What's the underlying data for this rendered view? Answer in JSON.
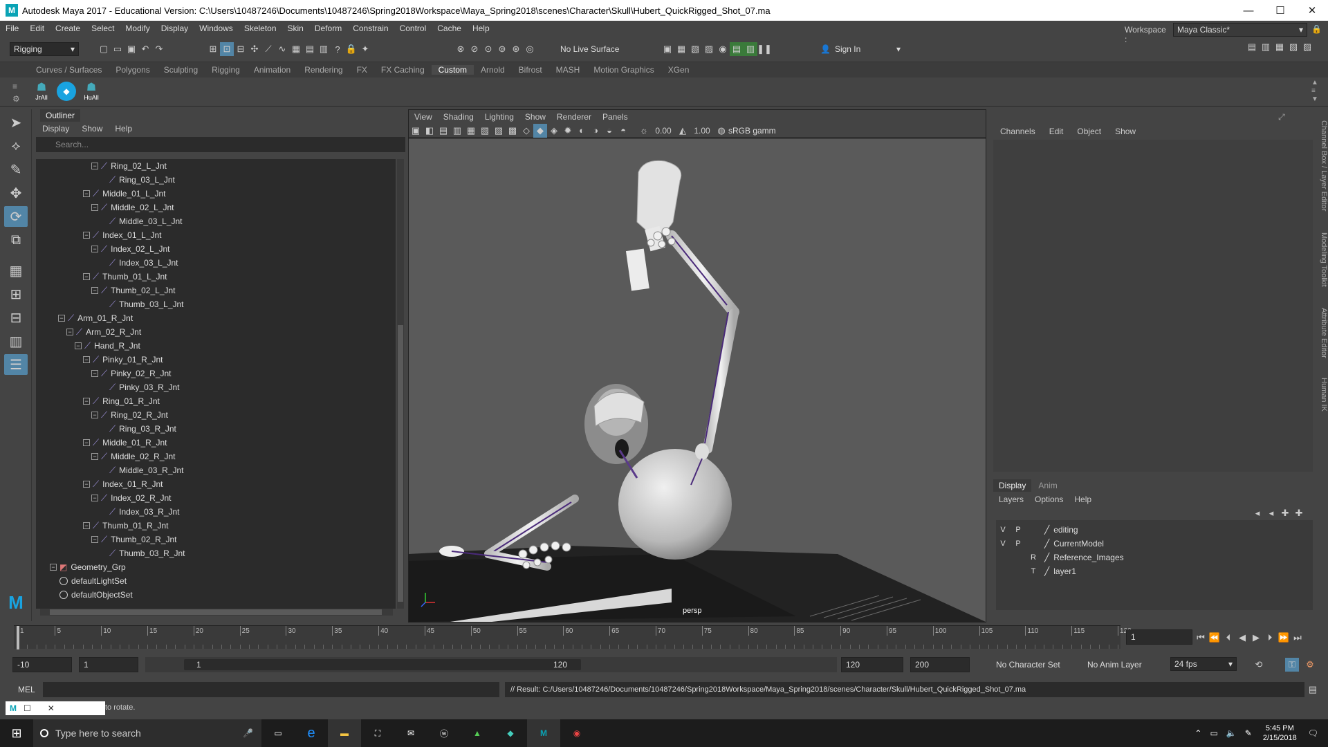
{
  "window": {
    "title": "Autodesk Maya 2017 - Educational Version: C:\\Users\\10487246\\Documents\\10487246\\Spring2018Workspace\\Maya_Spring2018\\scenes\\Character\\Skull\\Hubert_QuickRigged_Shot_07.ma",
    "logo": "M",
    "min": "—",
    "max": "☐",
    "close": "✕"
  },
  "menu": [
    "File",
    "Edit",
    "Create",
    "Select",
    "Modify",
    "Display",
    "Windows",
    "Skeleton",
    "Skin",
    "Deform",
    "Constrain",
    "Control",
    "Cache",
    "Help"
  ],
  "statusline": {
    "menuset": "Rigging",
    "live_surface": "No Live Surface",
    "sign_in": "Sign In",
    "workspace_label": "Workspace :",
    "workspace_value": "Maya Classic*"
  },
  "shelf_tabs": [
    {
      "label": "Curves / Surfaces",
      "active": false
    },
    {
      "label": "Polygons",
      "active": false
    },
    {
      "label": "Sculpting",
      "active": false
    },
    {
      "label": "Rigging",
      "active": false
    },
    {
      "label": "Animation",
      "active": false
    },
    {
      "label": "Rendering",
      "active": false
    },
    {
      "label": "FX",
      "active": false
    },
    {
      "label": "FX Caching",
      "active": false
    },
    {
      "label": "Custom",
      "active": true
    },
    {
      "label": "Arnold",
      "active": false
    },
    {
      "label": "Bifrost",
      "active": false
    },
    {
      "label": "MASH",
      "active": false
    },
    {
      "label": "Motion Graphics",
      "active": false
    },
    {
      "label": "XGen",
      "active": false
    }
  ],
  "shelf_icons": [
    "JrAll",
    "",
    "HuAll"
  ],
  "outliner": {
    "tab": "Outliner",
    "menu": [
      "Display",
      "Show",
      "Help"
    ],
    "search_placeholder": "Search...",
    "items": [
      {
        "label": "Ring_02_L_Jnt",
        "depth": 6,
        "kind": "joint",
        "exp": true
      },
      {
        "label": "Ring_03_L_Jnt",
        "depth": 7,
        "kind": "joint",
        "exp": false
      },
      {
        "label": "Middle_01_L_Jnt",
        "depth": 5,
        "kind": "joint",
        "exp": true
      },
      {
        "label": "Middle_02_L_Jnt",
        "depth": 6,
        "kind": "joint",
        "exp": true
      },
      {
        "label": "Middle_03_L_Jnt",
        "depth": 7,
        "kind": "joint",
        "exp": false
      },
      {
        "label": "Index_01_L_Jnt",
        "depth": 5,
        "kind": "joint",
        "exp": true
      },
      {
        "label": "Index_02_L_Jnt",
        "depth": 6,
        "kind": "joint",
        "exp": true
      },
      {
        "label": "Index_03_L_Jnt",
        "depth": 7,
        "kind": "joint",
        "exp": false
      },
      {
        "label": "Thumb_01_L_Jnt",
        "depth": 5,
        "kind": "joint",
        "exp": true
      },
      {
        "label": "Thumb_02_L_Jnt",
        "depth": 6,
        "kind": "joint",
        "exp": true
      },
      {
        "label": "Thumb_03_L_Jnt",
        "depth": 7,
        "kind": "joint",
        "exp": false
      },
      {
        "label": "Arm_01_R_Jnt",
        "depth": 2,
        "kind": "joint",
        "exp": true
      },
      {
        "label": "Arm_02_R_Jnt",
        "depth": 3,
        "kind": "joint",
        "exp": true
      },
      {
        "label": "Hand_R_Jnt",
        "depth": 4,
        "kind": "joint",
        "exp": true
      },
      {
        "label": "Pinky_01_R_Jnt",
        "depth": 5,
        "kind": "joint",
        "exp": true
      },
      {
        "label": "Pinky_02_R_Jnt",
        "depth": 6,
        "kind": "joint",
        "exp": true
      },
      {
        "label": "Pinky_03_R_Jnt",
        "depth": 7,
        "kind": "joint",
        "exp": false
      },
      {
        "label": "Ring_01_R_Jnt",
        "depth": 5,
        "kind": "joint",
        "exp": true
      },
      {
        "label": "Ring_02_R_Jnt",
        "depth": 6,
        "kind": "joint",
        "exp": true
      },
      {
        "label": "Ring_03_R_Jnt",
        "depth": 7,
        "kind": "joint",
        "exp": false
      },
      {
        "label": "Middle_01_R_Jnt",
        "depth": 5,
        "kind": "joint",
        "exp": true
      },
      {
        "label": "Middle_02_R_Jnt",
        "depth": 6,
        "kind": "joint",
        "exp": true
      },
      {
        "label": "Middle_03_R_Jnt",
        "depth": 7,
        "kind": "joint",
        "exp": false
      },
      {
        "label": "Index_01_R_Jnt",
        "depth": 5,
        "kind": "joint",
        "exp": true
      },
      {
        "label": "Index_02_R_Jnt",
        "depth": 6,
        "kind": "joint",
        "exp": true
      },
      {
        "label": "Index_03_R_Jnt",
        "depth": 7,
        "kind": "joint",
        "exp": false
      },
      {
        "label": "Thumb_01_R_Jnt",
        "depth": 5,
        "kind": "joint",
        "exp": true
      },
      {
        "label": "Thumb_02_R_Jnt",
        "depth": 6,
        "kind": "joint",
        "exp": true
      },
      {
        "label": "Thumb_03_R_Jnt",
        "depth": 7,
        "kind": "joint",
        "exp": false
      },
      {
        "label": "Geometry_Grp",
        "depth": 1,
        "kind": "group",
        "exp": true
      },
      {
        "label": "defaultLightSet",
        "depth": 1,
        "kind": "set",
        "exp": false
      },
      {
        "label": "defaultObjectSet",
        "depth": 1,
        "kind": "set",
        "exp": false
      }
    ]
  },
  "viewport": {
    "menu": [
      "View",
      "Shading",
      "Lighting",
      "Show",
      "Renderer",
      "Panels"
    ],
    "value_a": "0.00",
    "value_b": "1.00",
    "colorspace": "sRGB gamm",
    "camera": "persp"
  },
  "channelbox": {
    "menu": [
      "Channels",
      "Edit",
      "Object",
      "Show"
    ]
  },
  "layers": {
    "tabs": [
      "Display",
      "Anim"
    ],
    "menu": [
      "Layers",
      "Options",
      "Help"
    ],
    "rows": [
      {
        "v": "V",
        "p": "P",
        "r": "",
        "name": "editing"
      },
      {
        "v": "V",
        "p": "P",
        "r": "",
        "name": "CurrentModel"
      },
      {
        "v": "",
        "p": "",
        "r": "R",
        "name": "Reference_Images"
      },
      {
        "v": "",
        "p": "",
        "r": "T",
        "name": "layer1"
      }
    ]
  },
  "side_tabs": [
    "Channel Box / Layer Editor",
    "Modeling Toolkit",
    "Attribute Editor",
    "Human IK"
  ],
  "timeline": {
    "ticks": [
      "1",
      "5",
      "10",
      "15",
      "20",
      "25",
      "30",
      "35",
      "40",
      "45",
      "50",
      "55",
      "60",
      "65",
      "70",
      "75",
      "80",
      "85",
      "90",
      "95",
      "100",
      "105",
      "110",
      "115",
      "120"
    ],
    "current_frame": "1"
  },
  "range": {
    "start_min": "-10",
    "start": "1",
    "slider_start": "1",
    "slider_end": "120",
    "end": "120",
    "end_max": "200",
    "character_set": "No Character Set",
    "anim_layer": "No Anim Layer",
    "fps": "24 fps"
  },
  "cmdline": {
    "label": "MEL",
    "result": "// Result: C:/Users/10487246/Documents/10487246/Spring2018Workspace/Maya_Spring2018/scenes/Character/Skull/Hubert_QuickRigged_Shot_07.ma"
  },
  "helpline": {
    "text": "to rotate."
  },
  "taskbar": {
    "search_placeholder": "Type here to search",
    "time": "5:45 PM",
    "date": "2/15/2018"
  }
}
